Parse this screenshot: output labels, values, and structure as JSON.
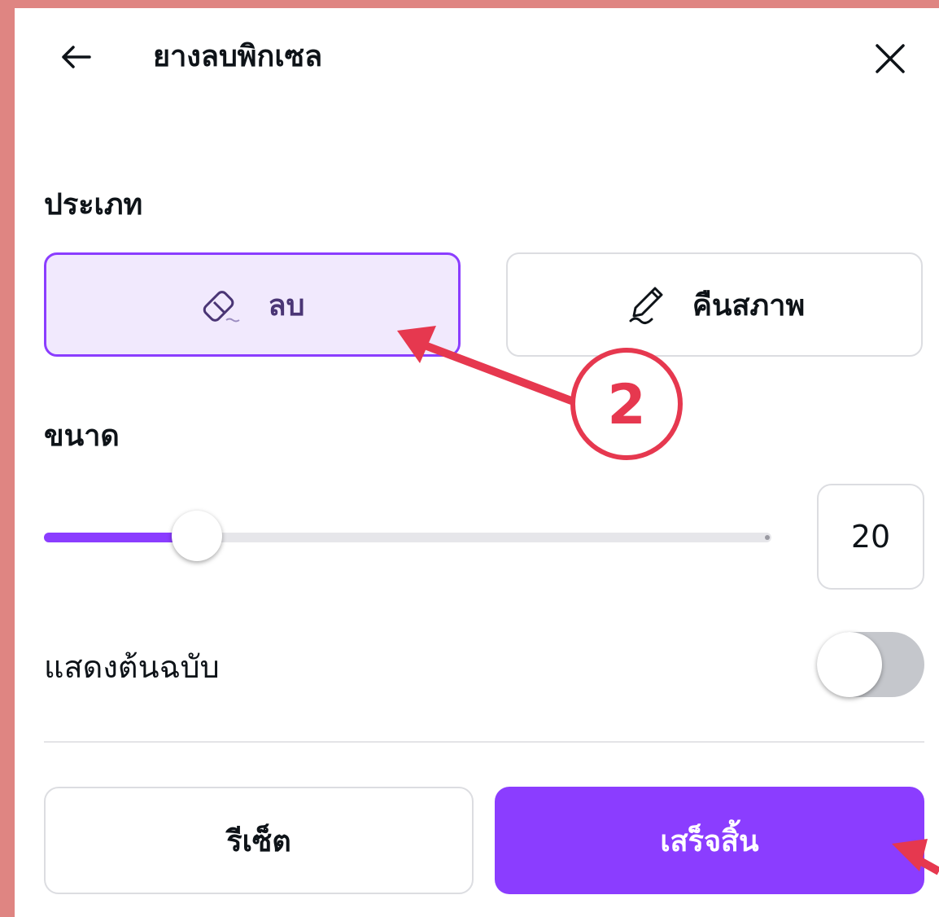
{
  "header": {
    "title": "ยางลบพิกเซล",
    "back_icon": "arrow-left-icon",
    "close_icon": "close-icon"
  },
  "type_section": {
    "label": "ประเภท",
    "options": [
      {
        "label": "ลบ",
        "icon": "eraser-icon",
        "selected": true
      },
      {
        "label": "คืนสภาพ",
        "icon": "pen-restore-icon",
        "selected": false
      }
    ]
  },
  "size_section": {
    "label": "ขนาด",
    "value": "20",
    "slider_fraction": 0.2
  },
  "show_original": {
    "label": "แสดงต้นฉบับ",
    "enabled": false
  },
  "footer": {
    "reset_label": "รีเซ็ต",
    "done_label": "เสร็จสิ้น"
  },
  "annotation": {
    "step_number": "2"
  },
  "colors": {
    "accent": "#8b3dff",
    "selected_bg": "#f1e9fd",
    "annotation_red": "#e6384f",
    "frame": "#df8582",
    "toggle_off": "#c5c7cc"
  }
}
